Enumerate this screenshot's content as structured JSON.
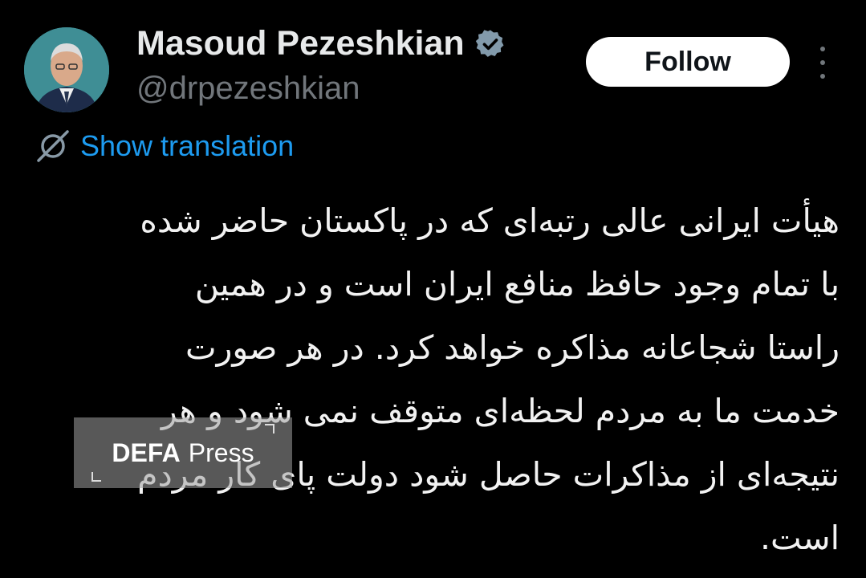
{
  "author": {
    "display_name": "Masoud Pezeshkian",
    "handle": "@drpezeshkian",
    "verified_icon": "verified-badge-icon"
  },
  "actions": {
    "follow_label": "Follow",
    "more_icon": "more-options-icon"
  },
  "translation": {
    "label": "Show translation",
    "icon": "translate-icon"
  },
  "tweet": {
    "lines": [
      "هیأت ایرانی عالی رتبه‌ای که در پاکستان حاضر شده",
      "با تمام وجود حافظ منافع ایران است و در همین",
      "راستا شجاعانه مذاکره خواهد کرد. در هر صورت",
      "خدمت ما به مردم لحظه‌ای متوقف نمی شود و هر",
      "نتیجه‌ای از مذاکرات حاصل شود دولت پای کار مردم",
      "است."
    ]
  },
  "watermark": {
    "bold": "DEFA",
    "text": "Press"
  },
  "colors": {
    "background": "#000000",
    "link": "#1d9bf0",
    "muted": "#71767b",
    "primary_text": "#e7e9ea"
  }
}
